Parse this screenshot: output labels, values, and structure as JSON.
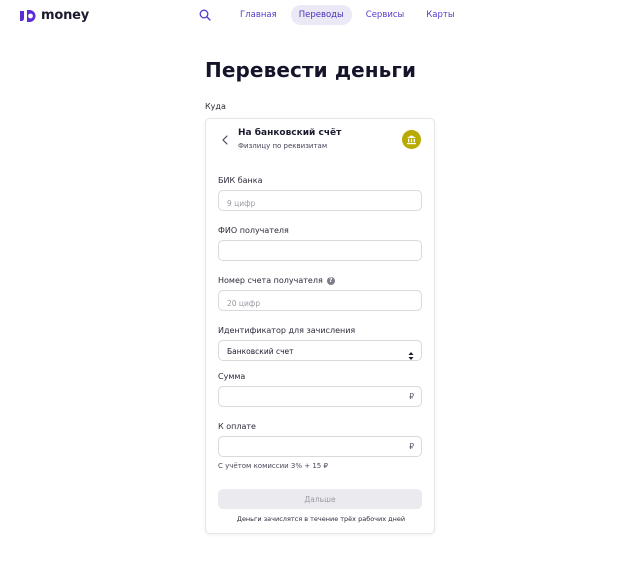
{
  "brand": {
    "name": "money",
    "color": "#5b2dd6"
  },
  "nav": {
    "search_icon": "search-icon",
    "items": [
      {
        "label": "Главная",
        "active": false
      },
      {
        "label": "Переводы",
        "active": true
      },
      {
        "label": "Сервисы",
        "active": false
      },
      {
        "label": "Карты",
        "active": false
      }
    ]
  },
  "page": {
    "title": "Перевести деньги",
    "destination_label": "Куда"
  },
  "method": {
    "title": "На банковский счёт",
    "subtitle": "Физлицу по реквизитам",
    "back_icon": "chevron-left-icon",
    "badge_icon": "bank-icon",
    "badge_color": "#b8aa00"
  },
  "form": {
    "bik": {
      "label": "БИК банка",
      "placeholder": "9 цифр",
      "value": ""
    },
    "recipient_name": {
      "label": "ФИО получателя",
      "placeholder": "",
      "value": ""
    },
    "account_number": {
      "label": "Номер счета получателя",
      "placeholder": "20 цифр",
      "value": "",
      "help_icon": "question-icon"
    },
    "identifier": {
      "label": "Идентификатор для зачисления",
      "selected": "Банковский счет"
    },
    "amount": {
      "label": "Сумма",
      "value": "",
      "currency": "₽"
    },
    "to_pay": {
      "label": "К оплате",
      "value": "",
      "currency": "₽"
    },
    "commission_note": "С учётом комиссии 3% + 15 ₽",
    "submit_label": "Дальше",
    "footer_note": "Деньги зачислятся в течение трёх рабочих дней"
  }
}
